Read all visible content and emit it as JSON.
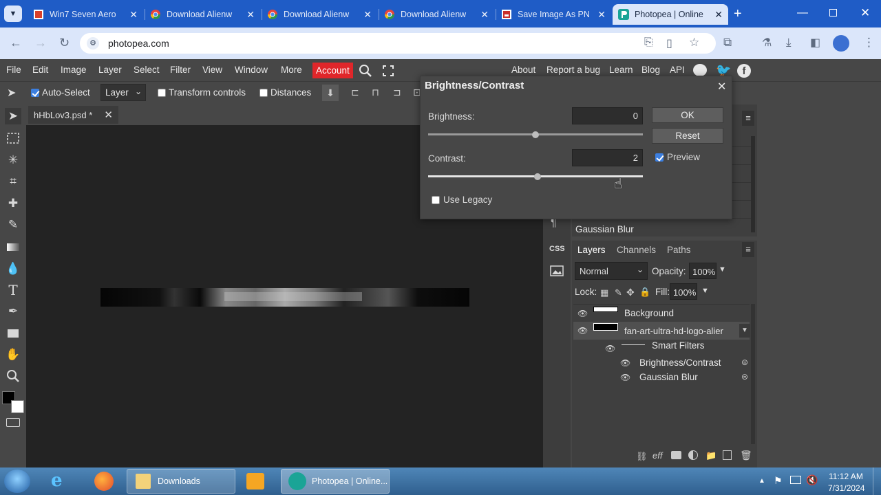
{
  "browser": {
    "tabs": [
      {
        "title": "Win7 Seven Aero",
        "icon": "windows-tab-icon",
        "active": false
      },
      {
        "title": "Download Alienw",
        "icon": "chrome-tab-icon",
        "active": false
      },
      {
        "title": "Download Alienw",
        "icon": "chrome-tab-icon",
        "active": false
      },
      {
        "title": "Download Alienw",
        "icon": "chrome-tab-icon",
        "active": false
      },
      {
        "title": "Save Image As PN",
        "icon": "image-tab-icon",
        "active": false
      },
      {
        "title": "Photopea | Online",
        "icon": "photopea-tab-icon",
        "active": true
      }
    ],
    "url": "photopea.com"
  },
  "menu": {
    "items": [
      "File",
      "Edit",
      "Image",
      "Layer",
      "Select",
      "Filter",
      "View",
      "Window",
      "More"
    ],
    "account": "Account",
    "right_items": [
      "About",
      "Report a bug",
      "Learn",
      "Blog",
      "API"
    ]
  },
  "options": {
    "auto_select": "Auto-Select",
    "auto_select_checked": true,
    "layer_dropdown": "Layer",
    "transform_controls": "Transform controls",
    "distances": "Distances"
  },
  "document": {
    "tab": "hHbLov3.psd *"
  },
  "dialog": {
    "title": "Brightness/Contrast",
    "brightness_label": "Brightness:",
    "brightness_value": "0",
    "contrast_label": "Contrast:",
    "contrast_value": "2",
    "brightness_position": 0.5,
    "contrast_position": 0.51,
    "ok": "OK",
    "reset": "Reset",
    "preview": "Preview",
    "preview_checked": true,
    "use_legacy": "Use Legacy",
    "use_legacy_checked": false
  },
  "history": {
    "last_item": "Gaussian Blur"
  },
  "iconstrip": {
    "css": "CSS"
  },
  "layers": {
    "tabs": [
      "Layers",
      "Channels",
      "Paths"
    ],
    "blend_mode": "Normal",
    "opacity_label": "Opacity:",
    "opacity": "100%",
    "lock_label": "Lock:",
    "fill_label": "Fill:",
    "fill": "100%",
    "items": [
      {
        "name": "Background"
      },
      {
        "name": "fan-art-ultra-hd-logo-alier"
      },
      {
        "name": "Smart Filters"
      },
      {
        "name": "Brightness/Contrast"
      },
      {
        "name": "Gaussian Blur"
      }
    ]
  },
  "taskbar": {
    "downloads": "Downloads",
    "photopea": "Photopea | Online...",
    "time": "11:12 AM",
    "date": "7/31/2024"
  },
  "colors": {
    "accent": "#e0262a",
    "chrome_blue": "#1f5cc6",
    "panel": "#474747"
  }
}
